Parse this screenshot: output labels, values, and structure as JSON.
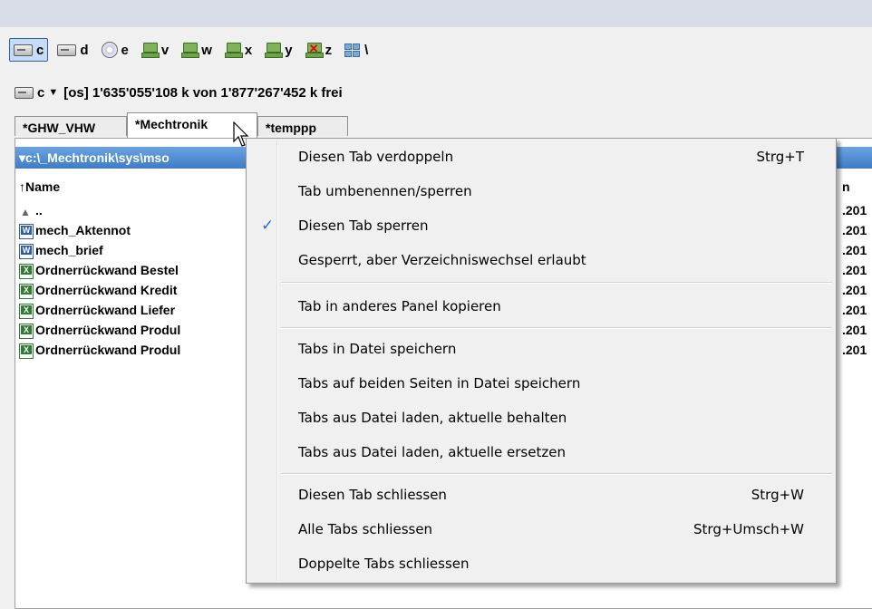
{
  "drives": [
    {
      "label": "c",
      "icon": "hard-drive-icon",
      "active": true
    },
    {
      "label": "d",
      "icon": "hard-drive-icon",
      "active": false
    },
    {
      "label": "e",
      "icon": "cd-drive-icon",
      "active": false
    },
    {
      "label": "v",
      "icon": "network-drive-icon",
      "active": false
    },
    {
      "label": "w",
      "icon": "network-drive-icon",
      "active": false
    },
    {
      "label": "x",
      "icon": "network-drive-icon",
      "active": false
    },
    {
      "label": "y",
      "icon": "network-drive-icon",
      "active": false
    },
    {
      "label": "z",
      "icon": "disconnected-network-drive-icon",
      "active": false
    },
    {
      "label": "\\",
      "icon": "network-tree-icon",
      "active": false
    }
  ],
  "pathbar": {
    "drive": "c",
    "info": "[os]  1'635'055'108 k von 1'877'267'452 k frei"
  },
  "tabs": [
    "*GHW_VHW",
    "*Mechtronik",
    "*temppp"
  ],
  "panel": {
    "current_path": "▾c:\\_Mechtronik\\sys\\mso",
    "col_name": "↑Name",
    "col_date_partial": "n",
    "rows": [
      {
        "name": "..",
        "type": "up",
        "date": ".201"
      },
      {
        "name": "mech_Aktennot",
        "type": "word",
        "date": ".201"
      },
      {
        "name": "mech_brief",
        "type": "word",
        "date": ".201"
      },
      {
        "name": "Ordnerrückwand Bestel",
        "type": "excel",
        "date": ".201"
      },
      {
        "name": "Ordnerrückwand Kredit",
        "type": "excel",
        "date": ".201"
      },
      {
        "name": "Ordnerrückwand Liefer",
        "type": "excel",
        "date": ".201"
      },
      {
        "name": "Ordnerrückwand Produl",
        "type": "excel",
        "date": ".201"
      },
      {
        "name": "Ordnerrückwand Produl",
        "type": "excel",
        "date": ".201"
      }
    ]
  },
  "context_menu": {
    "items": [
      {
        "label": "Diesen Tab verdoppeln",
        "shortcut": "Strg+T",
        "checked": false
      },
      {
        "label": "Tab umbenennen/sperren",
        "shortcut": "",
        "checked": false
      },
      {
        "label": "Diesen Tab sperren",
        "shortcut": "",
        "checked": true
      },
      {
        "label": "Gesperrt, aber Verzeichniswechsel erlaubt",
        "shortcut": "",
        "checked": false
      },
      {
        "label": "Tab in anderes Panel kopieren",
        "shortcut": "",
        "checked": false
      },
      {
        "label": "Tabs in Datei speichern",
        "shortcut": "",
        "checked": false
      },
      {
        "label": "Tabs auf beiden Seiten in Datei speichern",
        "shortcut": "",
        "checked": false
      },
      {
        "label": "Tabs aus Datei laden, aktuelle behalten",
        "shortcut": "",
        "checked": false
      },
      {
        "label": "Tabs aus Datei laden, aktuelle ersetzen",
        "shortcut": "",
        "checked": false
      },
      {
        "label": "Diesen Tab schliessen",
        "shortcut": "Strg+W",
        "checked": false
      },
      {
        "label": "Alle Tabs schliessen",
        "shortcut": "Strg+Umsch+W",
        "checked": false
      },
      {
        "label": "Doppelte Tabs schliessen",
        "shortcut": "",
        "checked": false
      }
    ],
    "check_mark": "✓"
  },
  "colors": {
    "accent": "#3f7cc8",
    "check": "#2d6ad6"
  }
}
